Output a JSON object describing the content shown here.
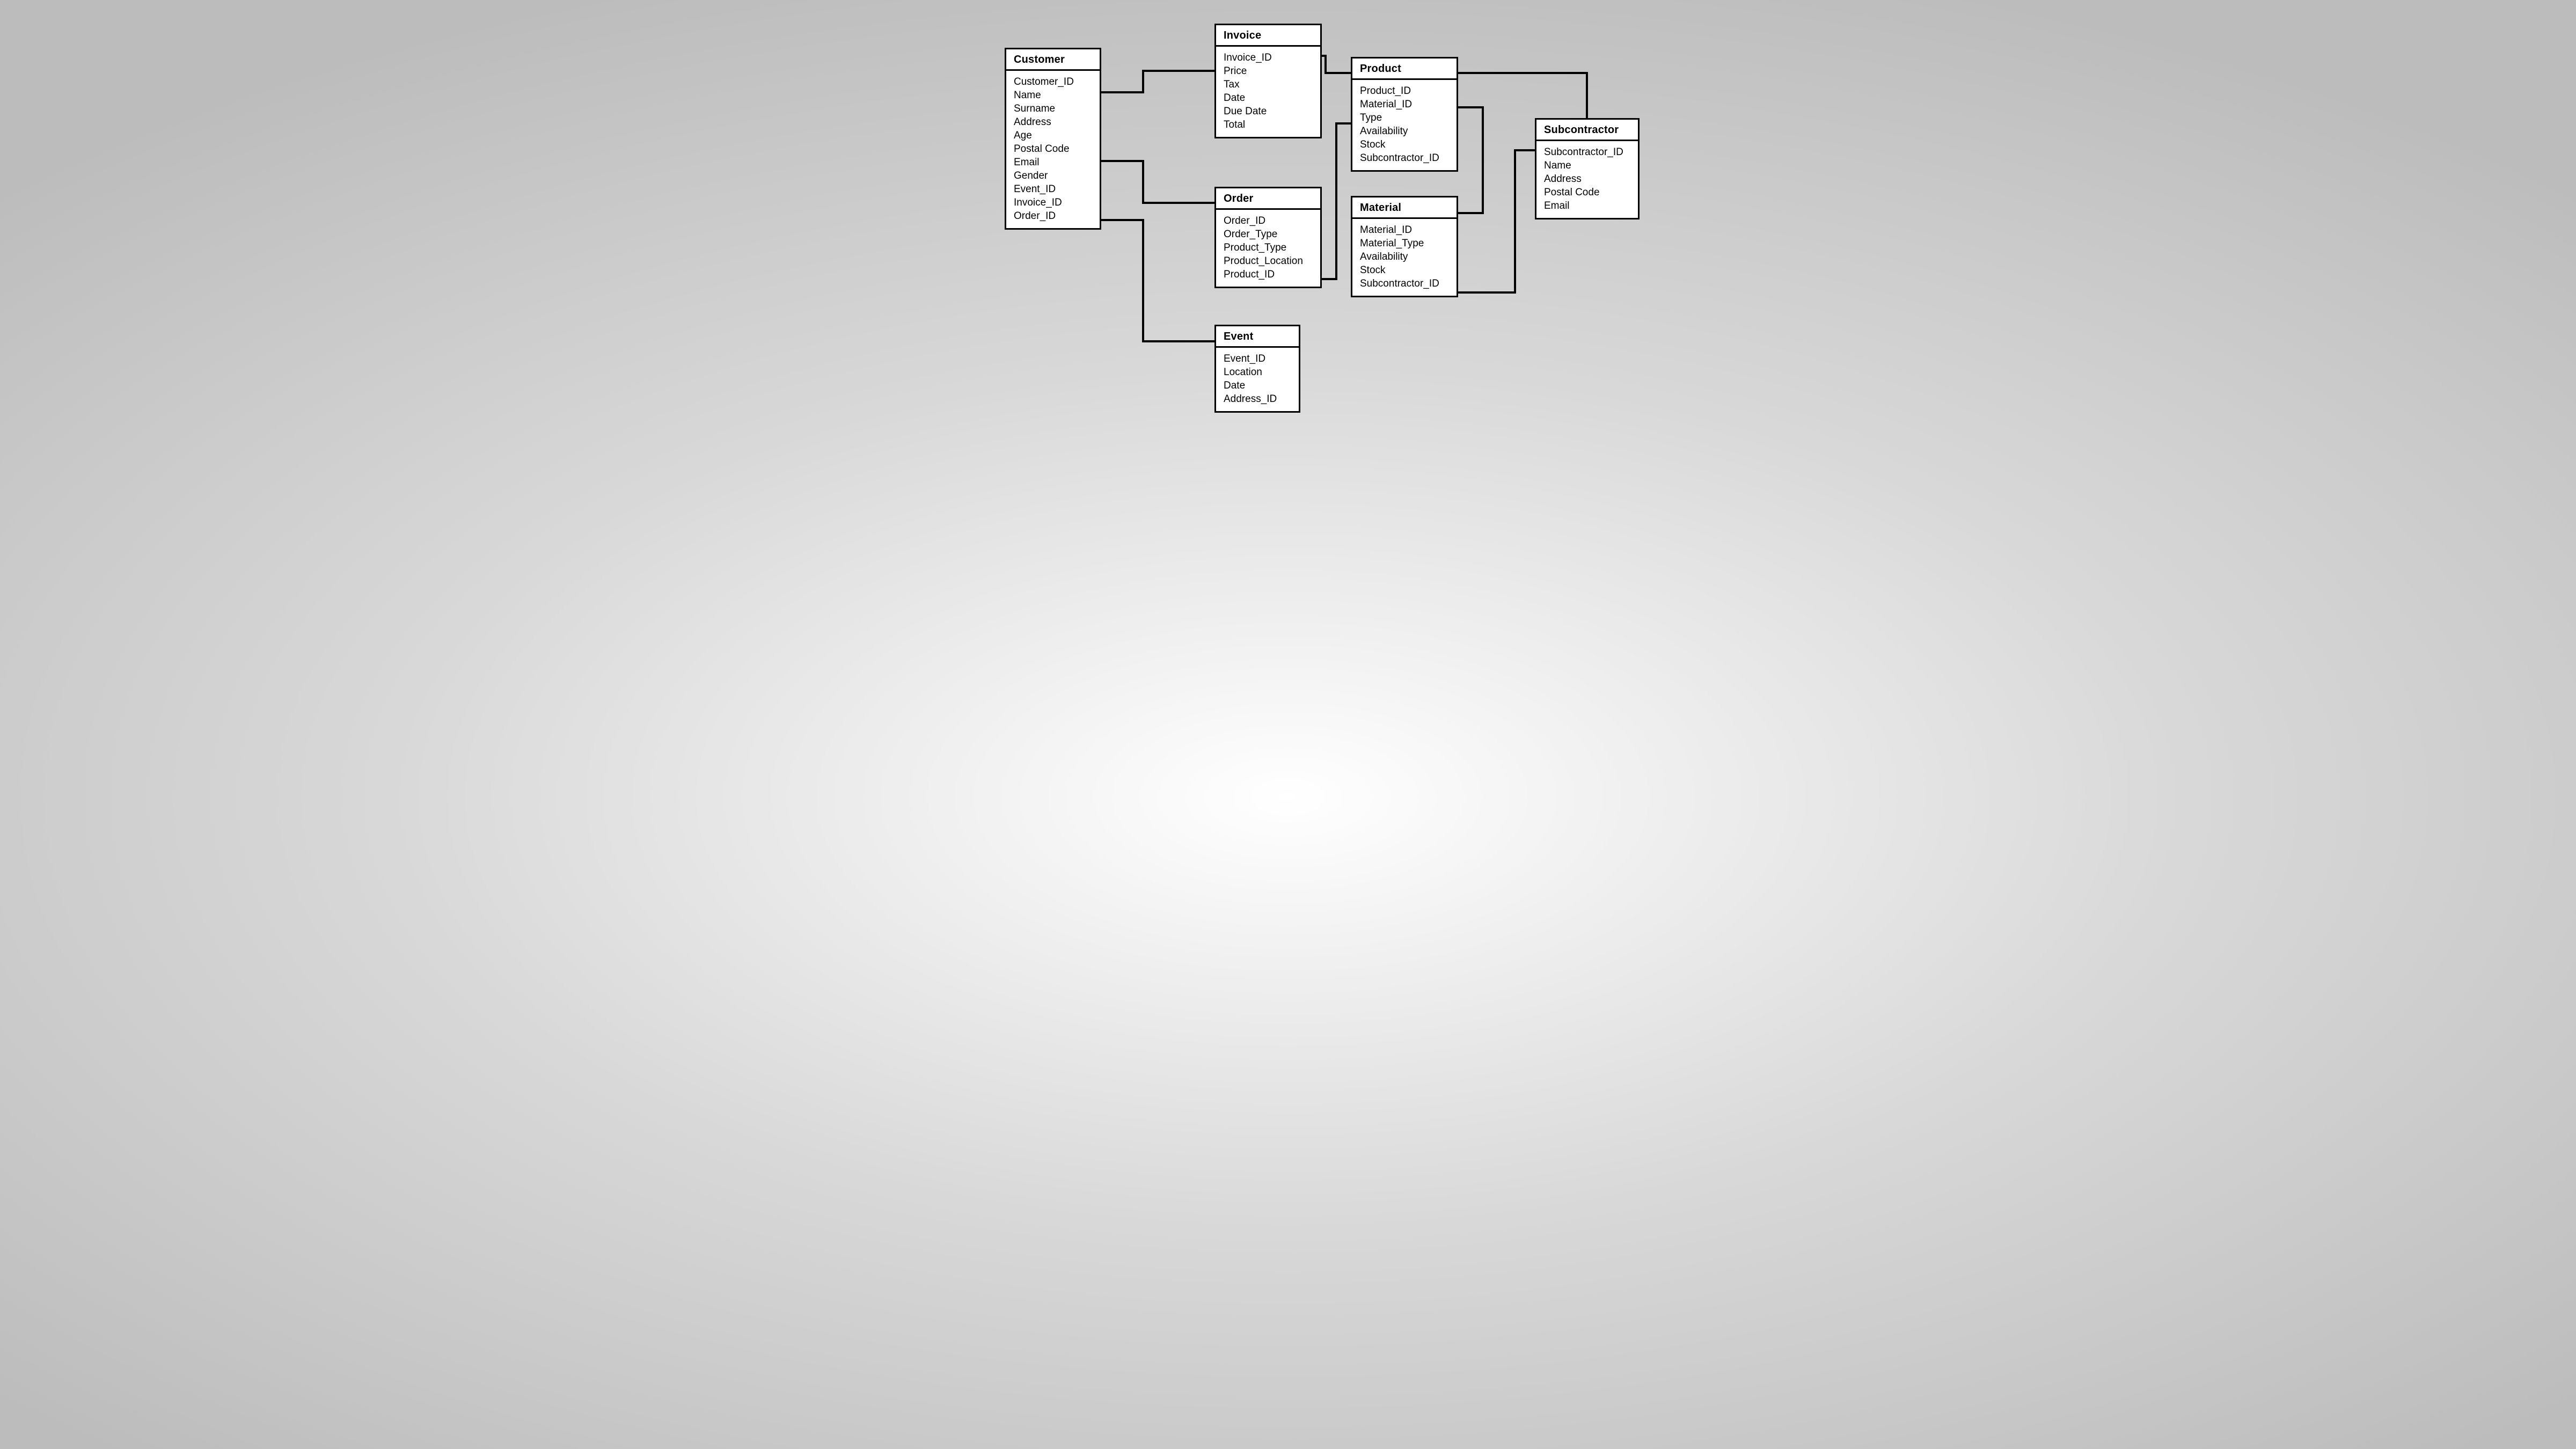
{
  "entities": {
    "customer": {
      "title": "Customer",
      "fields": [
        "Customer_ID",
        "Name",
        "Surname",
        "Address",
        "Age",
        "Postal Code",
        "Email",
        "Gender",
        "Event_ID",
        "Invoice_ID",
        "Order_ID"
      ]
    },
    "invoice": {
      "title": "Invoice",
      "fields": [
        "Invoice_ID",
        "Price",
        "Tax",
        "Date",
        "Due Date",
        "Total"
      ]
    },
    "order": {
      "title": "Order",
      "fields": [
        "Order_ID",
        "Order_Type",
        "Product_Type",
        "Product_Location",
        "Product_ID"
      ]
    },
    "event": {
      "title": "Event",
      "fields": [
        "Event_ID",
        "Location",
        "Date",
        "Address_ID"
      ]
    },
    "product": {
      "title": "Product",
      "fields": [
        "Product_ID",
        "Material_ID",
        "Type",
        "Availability",
        "Stock",
        "Subcontractor_ID"
      ]
    },
    "material": {
      "title": "Material",
      "fields": [
        "Material_ID",
        "Material_Type",
        "Availability",
        "Stock",
        "Subcontractor_ID"
      ]
    },
    "subcontractor": {
      "title": "Subcontractor",
      "fields": [
        "Subcontractor_ID",
        "Name",
        "Address",
        "Postal Code",
        "Email"
      ]
    }
  }
}
